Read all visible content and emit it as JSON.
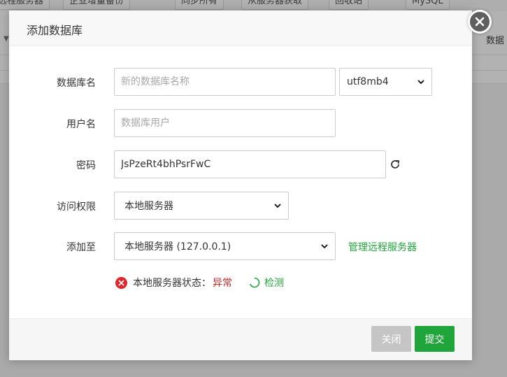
{
  "background": {
    "toolbar_buttons": [
      "远程服务器",
      "企业增量备份",
      "同步所有",
      "从服务器获取",
      "回收站",
      "MySQL"
    ],
    "right_column_label": "数据"
  },
  "dialog": {
    "title": "添加数据库",
    "db_name_label": "数据库名",
    "db_name_placeholder": "新的数据库名称",
    "charset_value": "utf8mb4",
    "username_label": "用户名",
    "username_placeholder": "数据库用户",
    "password_label": "密码",
    "password_value": "JsPzeRt4bhPsrFwC",
    "access_label": "访问权限",
    "access_value": "本地服务器",
    "add_to_label": "添加至",
    "add_to_value": "本地服务器 (127.0.0.1)",
    "manage_remote_link": "管理远程服务器",
    "status_label": "本地服务器状态：",
    "status_value": "异常",
    "check_link": "检测",
    "close_button": "关闭",
    "submit_button": "提交"
  },
  "colors": {
    "accent_green": "#20a53a",
    "error_red": "#e0262d",
    "disabled_gray": "#c5c5c5"
  },
  "icons": [
    "close-icon",
    "refresh-icon",
    "chevron-down-icon",
    "error-icon",
    "loading-icon"
  ]
}
